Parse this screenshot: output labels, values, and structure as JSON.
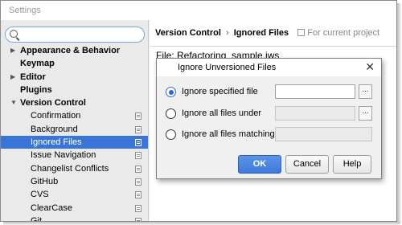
{
  "window": {
    "title": "Settings"
  },
  "search": {
    "placeholder": ""
  },
  "sidebar": {
    "items": [
      {
        "label": "Appearance & Behavior",
        "arrow": "▶"
      },
      {
        "label": "Keymap",
        "arrow": ""
      },
      {
        "label": "Editor",
        "arrow": "▶"
      },
      {
        "label": "Plugins",
        "arrow": ""
      },
      {
        "label": "Version Control",
        "arrow": "▼"
      },
      {
        "label": "Confirmation"
      },
      {
        "label": "Background"
      },
      {
        "label": "Ignored Files",
        "selected": true
      },
      {
        "label": "Issue Navigation"
      },
      {
        "label": "Changelist Conflicts"
      },
      {
        "label": "GitHub"
      },
      {
        "label": "CVS"
      },
      {
        "label": "ClearCase"
      },
      {
        "label": "Git"
      }
    ]
  },
  "main": {
    "breadcrumb": {
      "parent": "Version Control",
      "separator": "›",
      "current": "Ignored Files",
      "scope": "For current project"
    },
    "file_line": "File: Refactoring_sample.iws"
  },
  "dialog": {
    "title": "Ignore Unversioned Files",
    "close": "✕",
    "options": [
      {
        "label": "Ignore specified file",
        "checked": true
      },
      {
        "label": "Ignore all files under",
        "checked": false
      },
      {
        "label": "Ignore all files matching",
        "checked": false
      }
    ],
    "browse_label": "...",
    "buttons": {
      "ok": "OK",
      "cancel": "Cancel",
      "help": "Help"
    }
  },
  "colors": {
    "selection": "#3875d7",
    "ok_button": "#3f79d8"
  }
}
